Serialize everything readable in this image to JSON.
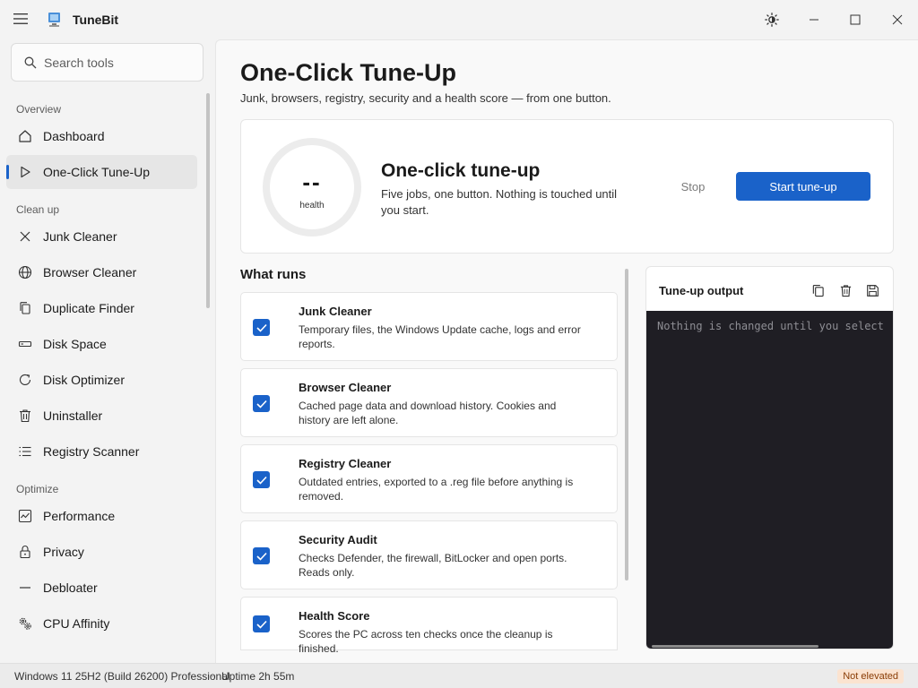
{
  "app": {
    "name": "TuneBit"
  },
  "search": {
    "placeholder": "Search tools"
  },
  "sidebar": {
    "sections": [
      {
        "label": "Overview"
      },
      {
        "label": "Clean up"
      },
      {
        "label": "Optimize"
      }
    ],
    "items": [
      {
        "label": "Dashboard",
        "icon": "home-icon"
      },
      {
        "label": "One-Click Tune-Up",
        "icon": "play-icon",
        "active": true
      },
      {
        "label": "Junk Cleaner",
        "icon": "x-icon"
      },
      {
        "label": "Browser Cleaner",
        "icon": "globe-icon"
      },
      {
        "label": "Duplicate Finder",
        "icon": "copy-icon"
      },
      {
        "label": "Disk Space",
        "icon": "disk-icon"
      },
      {
        "label": "Disk Optimizer",
        "icon": "refresh-icon"
      },
      {
        "label": "Uninstaller",
        "icon": "trash-icon"
      },
      {
        "label": "Registry Scanner",
        "icon": "list-icon"
      },
      {
        "label": "Performance",
        "icon": "chart-icon"
      },
      {
        "label": "Privacy",
        "icon": "lock-icon"
      },
      {
        "label": "Debloater",
        "icon": "minus-icon"
      },
      {
        "label": "CPU Affinity",
        "icon": "gears-icon"
      }
    ]
  },
  "page": {
    "title": "One-Click Tune-Up",
    "subtitle": "Junk, browsers, registry, security and a health score — from one button."
  },
  "hero": {
    "health_value": "--",
    "health_label": "health",
    "title": "One-click tune-up",
    "description": "Five jobs, one button. Nothing is touched until you start.",
    "stop_label": "Stop",
    "start_label": "Start tune-up"
  },
  "runs": {
    "title": "What runs",
    "jobs": [
      {
        "title": "Junk Cleaner",
        "description": "Temporary files, the Windows Update cache, logs and error reports.",
        "checked": true
      },
      {
        "title": "Browser Cleaner",
        "description": "Cached page data and download history. Cookies and history are left alone.",
        "checked": true
      },
      {
        "title": "Registry Cleaner",
        "description": "Outdated entries, exported to a .reg file before anything is removed.",
        "checked": true
      },
      {
        "title": "Security Audit",
        "description": "Checks Defender, the firewall, BitLocker and open ports. Reads only.",
        "checked": true
      },
      {
        "title": "Health Score",
        "description": "Scores the PC across ten checks once the cleanup is finished.",
        "checked": true
      }
    ]
  },
  "output": {
    "title": "Tune-up output",
    "text": "Nothing is changed until you select"
  },
  "status": {
    "os": "Windows 11 25H2 (Build 26200) Professional",
    "separator": "·",
    "uptime": "Uptime 2h 55m",
    "badge": "Not elevated"
  },
  "colors": {
    "accent": "#1a62c9",
    "console_bg": "#1f1e24",
    "badge_bg": "#fbe3d0"
  }
}
